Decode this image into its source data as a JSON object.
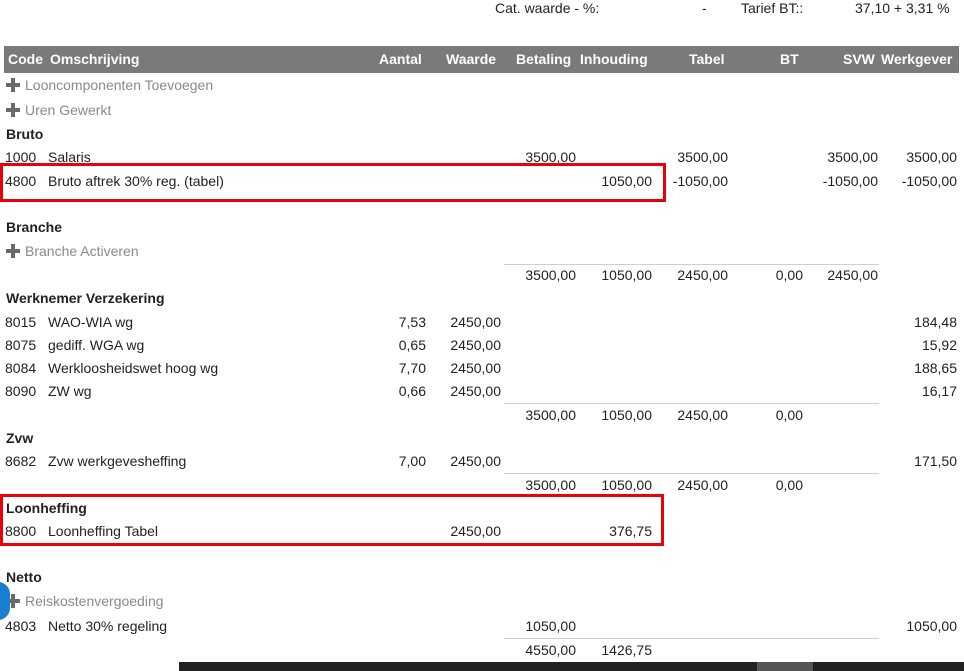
{
  "top": {
    "cat_label": "Cat. waarde - %:",
    "cat_value": "-",
    "tarief_label": "Tarief BT::",
    "tarief_value": "37,10 + 3,31 %"
  },
  "columns": {
    "code": "Code",
    "omschrijving": "Omschrijving",
    "aantal": "Aantal",
    "waarde": "Waarde",
    "betaling": "Betaling",
    "inhouding": "Inhouding",
    "tabel": "Tabel",
    "bt": "BT",
    "svw": "SVW",
    "werkgever": "Werkgever"
  },
  "links": {
    "looncomponenten": "Looncomponenten Toevoegen",
    "uren": "Uren Gewerkt",
    "branche": "Branche Activeren",
    "reiskosten": "Reiskostenvergoeding"
  },
  "sections": {
    "bruto": "Bruto",
    "branche": "Branche",
    "werknemer": "Werknemer Verzekering",
    "zvw": "Zvw",
    "loonheffing": "Loonheffing",
    "netto": "Netto"
  },
  "rows": {
    "r1000": {
      "code": "1000",
      "desc": "Salaris",
      "betaling": "3500,00",
      "tabel": "3500,00",
      "svw": "3500,00",
      "werkgever": "3500,00"
    },
    "r4800": {
      "code": "4800",
      "desc": "Bruto aftrek 30% reg. (tabel)",
      "inhouding": "1050,00",
      "tabel": "-1050,00",
      "svw": "-1050,00",
      "werkgever": "-1050,00"
    },
    "r8015": {
      "code": "8015",
      "desc": "WAO-WIA wg",
      "aantal": "7,53",
      "waarde": "2450,00",
      "werkgever": "184,48"
    },
    "r8075": {
      "code": "8075",
      "desc": "gediff. WGA wg",
      "aantal": "0,65",
      "waarde": "2450,00",
      "werkgever": "15,92"
    },
    "r8084": {
      "code": "8084",
      "desc": "Werkloosheidswet hoog wg",
      "aantal": "7,70",
      "waarde": "2450,00",
      "werkgever": "188,65"
    },
    "r8090": {
      "code": "8090",
      "desc": "ZW wg",
      "aantal": "0,66",
      "waarde": "2450,00",
      "werkgever": "16,17"
    },
    "r8682": {
      "code": "8682",
      "desc": "Zvw werkgevesheffing",
      "aantal": "7,00",
      "waarde": "2450,00",
      "werkgever": "171,50"
    },
    "r8800": {
      "code": "8800",
      "desc": "Loonheffing Tabel",
      "waarde": "2450,00",
      "inhouding": "376,75"
    },
    "r4803": {
      "code": "4803",
      "desc": "Netto 30% regeling",
      "betaling": "1050,00",
      "werkgever": "1050,00"
    }
  },
  "subtotals": {
    "branche": {
      "betaling": "3500,00",
      "inhouding": "1050,00",
      "tabel": "2450,00",
      "bt": "0,00",
      "svw": "2450,00"
    },
    "werknemer": {
      "betaling": "3500,00",
      "inhouding": "1050,00",
      "tabel": "2450,00",
      "bt": "0,00"
    },
    "zvw": {
      "betaling": "3500,00",
      "inhouding": "1050,00",
      "tabel": "2450,00",
      "bt": "0,00"
    },
    "netto": {
      "betaling": "4550,00",
      "inhouding": "1426,75"
    }
  }
}
